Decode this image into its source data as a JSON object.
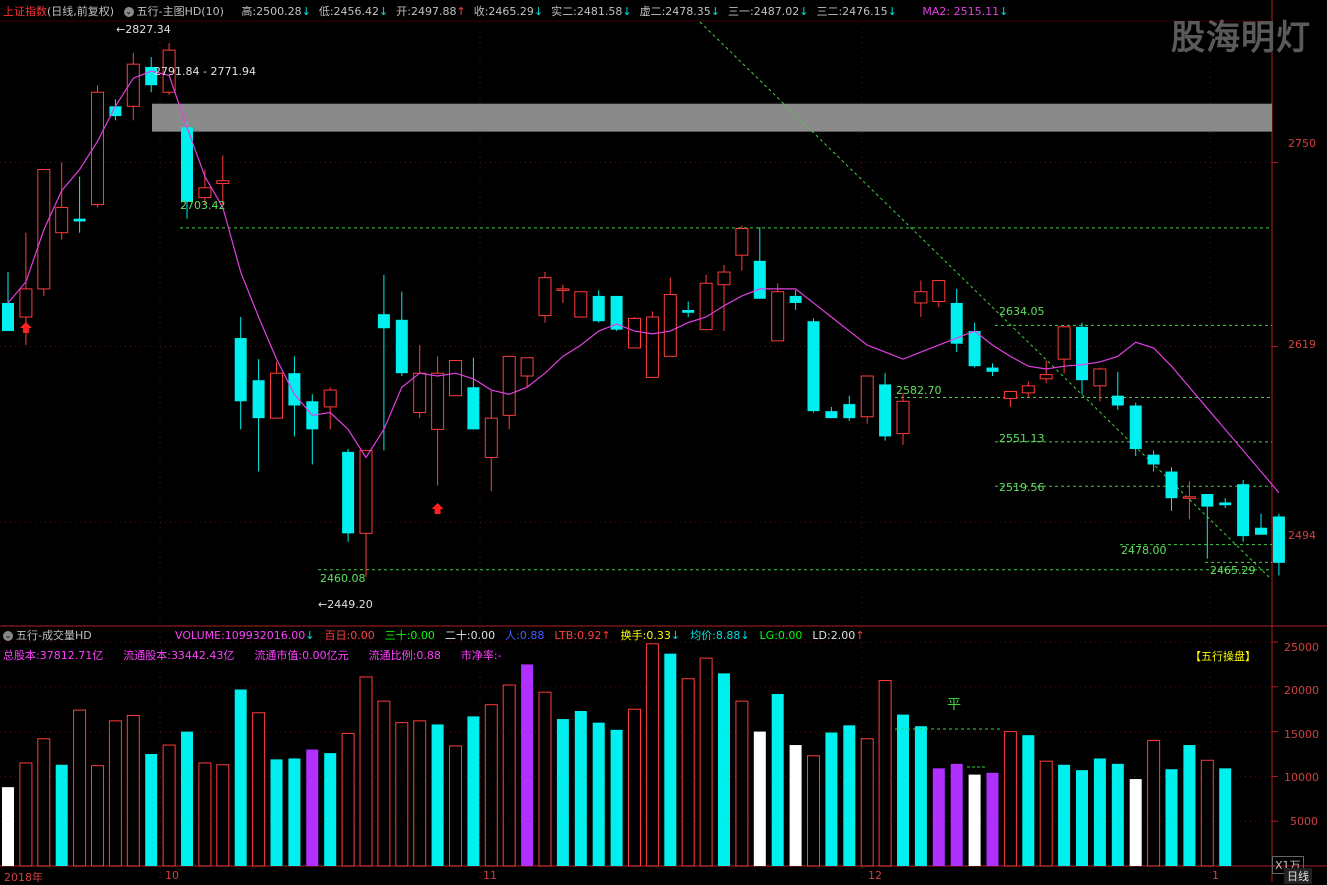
{
  "header": {
    "index_name": "上证指数",
    "period": "(日线,前复权)",
    "indicator_menu": "五行-主图HD(10)",
    "fields": [
      {
        "label": "高:",
        "value": "2500.28",
        "arrow": "↓",
        "color": "#00e0e0"
      },
      {
        "label": "低:",
        "value": "2456.42",
        "arrow": "↓",
        "color": "#00e0e0"
      },
      {
        "label": "开:",
        "value": "2497.88",
        "arrow": "↑",
        "color": "#ff4040"
      },
      {
        "label": "收:",
        "value": "2465.29",
        "arrow": "↓",
        "color": "#00e0e0"
      },
      {
        "label": "实二:",
        "value": "2481.58",
        "arrow": "↓",
        "color": "#00e0e0"
      },
      {
        "label": "虚二:",
        "value": "2478.35",
        "arrow": "↓",
        "color": "#00e0e0"
      },
      {
        "label": "三一:",
        "value": "2487.02",
        "arrow": "↓",
        "color": "#00e0e0"
      },
      {
        "label": "三二:",
        "value": "2476.15",
        "arrow": "↓",
        "color": "#00e0e0"
      }
    ],
    "ma2_label": "MA2: 2515.11",
    "ma2_arrow": "↓"
  },
  "watermark": "股海明灯",
  "price_axis": [
    "2750",
    "2619",
    "2494"
  ],
  "annotations": {
    "high_point": "2827.34",
    "band_range": "2791.84 - 2771.94",
    "level_2703": "2703.42",
    "level_2634": "2634.05",
    "level_2582": "2582.70",
    "level_2551": "2551.13",
    "level_2519": "2519.56",
    "level_2478": "2478.00",
    "level_2465": "2465.29",
    "level_2460": "2460.08",
    "low_point": "2449.20"
  },
  "volume_panel": {
    "title": "五行-成交量HD",
    "fields": [
      {
        "label": "VOLUME:",
        "value": "109932016.00",
        "arrow": "↓",
        "color": "#ff40ff"
      },
      {
        "label": "百日:",
        "value": "0.00",
        "arrow": "",
        "color": "#ff4040"
      },
      {
        "label": "三十:",
        "value": "0.00",
        "arrow": "",
        "color": "#00ff00"
      },
      {
        "label": "二十:",
        "value": "0.00",
        "arrow": "",
        "color": "#e0e0e0"
      },
      {
        "label": "人:",
        "value": "0.88",
        "arrow": "",
        "color": "#4060ff"
      },
      {
        "label": "LTB:",
        "value": "0.92",
        "arrow": "↑",
        "color": "#ff4040"
      },
      {
        "label": "换手:",
        "value": "0.33",
        "arrow": "↓",
        "color": "#ffff00"
      },
      {
        "label": "均价:",
        "value": "8.88",
        "arrow": "↓",
        "color": "#00e0e0"
      },
      {
        "label": "LG:",
        "value": "0.00",
        "arrow": "",
        "color": "#00ff00"
      },
      {
        "label": "LD:",
        "value": "2.00",
        "arrow": "↑",
        "color": "#e0e0e0"
      }
    ],
    "line2": [
      {
        "label": "总股本:",
        "value": "37812.71亿",
        "color": "#ff40ff"
      },
      {
        "label": "流通股本:",
        "value": "33442.43亿",
        "color": "#ff40ff"
      },
      {
        "label": "流通市值:",
        "value": "0.00亿元",
        "color": "#ff40ff"
      },
      {
        "label": "流通比例:",
        "value": "0.88",
        "color": "#ff40ff"
      },
      {
        "label": "市净率:",
        "value": "-",
        "color": "#ff40ff"
      }
    ],
    "operate_tag": "【五行操盘】",
    "flat_mark": "平",
    "axis": [
      "25000",
      "20000",
      "15000",
      "10000",
      "5000"
    ],
    "unit": "X1万"
  },
  "time_axis": [
    "2018年",
    "10",
    "11",
    "12",
    "1"
  ],
  "period_tab": "日线",
  "colors": {
    "up": "#ff3c3c",
    "down": "#00f0f0",
    "ma": "#e040e0",
    "level": "#40d040",
    "axis": "#b02020"
  },
  "chart_data": {
    "type": "candlestick",
    "ohlc": [
      [
        2650,
        2672,
        2632,
        2630
      ],
      [
        2640,
        2700,
        2620,
        2660
      ],
      [
        2660,
        2745,
        2655,
        2745
      ],
      [
        2700,
        2750,
        2695,
        2718
      ],
      [
        2710,
        2740,
        2700,
        2708
      ],
      [
        2720,
        2805,
        2718,
        2800
      ],
      [
        2790,
        2795,
        2780,
        2783
      ],
      [
        2790,
        2828,
        2780,
        2820
      ],
      [
        2818,
        2825,
        2800,
        2805
      ],
      [
        2800,
        2835,
        2798,
        2830
      ],
      [
        2775,
        2779,
        2710,
        2722
      ],
      [
        2725,
        2745,
        2720,
        2732
      ],
      [
        2735,
        2755,
        2720,
        2737
      ],
      [
        2625,
        2640,
        2560,
        2580
      ],
      [
        2595,
        2610,
        2530,
        2568
      ],
      [
        2568,
        2608,
        2568,
        2600
      ],
      [
        2600,
        2612,
        2555,
        2577
      ],
      [
        2580,
        2585,
        2535,
        2560
      ],
      [
        2576,
        2590,
        2560,
        2588
      ],
      [
        2544,
        2546,
        2480,
        2486
      ],
      [
        2486,
        2545,
        2455,
        2545
      ],
      [
        2642,
        2670,
        2545,
        2632
      ],
      [
        2638,
        2658,
        2598,
        2600
      ],
      [
        2572,
        2620,
        2568,
        2600
      ],
      [
        2560,
        2612,
        2520,
        2600
      ],
      [
        2584,
        2606,
        2592,
        2609
      ],
      [
        2590,
        2611,
        2560,
        2560
      ],
      [
        2540,
        2588,
        2516,
        2568
      ],
      [
        2570,
        2605,
        2560,
        2612
      ],
      [
        2598,
        2601,
        2590,
        2611
      ],
      [
        2641,
        2672,
        2636,
        2668
      ],
      [
        2660,
        2663,
        2650,
        2660
      ],
      [
        2640,
        2655,
        2640,
        2658
      ],
      [
        2655,
        2659,
        2636,
        2637
      ],
      [
        2655,
        2655,
        2630,
        2631
      ],
      [
        2618,
        2640,
        2618,
        2639
      ],
      [
        2597,
        2644,
        2605,
        2640
      ],
      [
        2612,
        2668,
        2615,
        2656
      ],
      [
        2645,
        2651,
        2640,
        2643
      ],
      [
        2631,
        2670,
        2632,
        2664
      ],
      [
        2663,
        2677,
        2630,
        2672
      ],
      [
        2684,
        2705,
        2673,
        2703
      ],
      [
        2680,
        2704,
        2653,
        2653
      ],
      [
        2623,
        2664,
        2628,
        2658
      ],
      [
        2655,
        2659,
        2645,
        2650
      ],
      [
        2637,
        2639,
        2572,
        2573
      ],
      [
        2573,
        2576,
        2569,
        2568
      ],
      [
        2578,
        2584,
        2566,
        2568
      ],
      [
        2569,
        2595,
        2564,
        2598
      ],
      [
        2592,
        2600,
        2552,
        2555
      ],
      [
        2557,
        2586,
        2549,
        2580
      ],
      [
        2650,
        2666,
        2640,
        2658
      ],
      [
        2651,
        2666,
        2647,
        2666
      ],
      [
        2650,
        2660,
        2615,
        2621
      ],
      [
        2630,
        2636,
        2604,
        2605
      ],
      [
        2604,
        2607,
        2598,
        2601
      ],
      [
        2582,
        2587,
        2576,
        2587
      ],
      [
        2586,
        2594,
        2583,
        2591
      ],
      [
        2596,
        2609,
        2593,
        2599
      ],
      [
        2610,
        2634,
        2600,
        2633
      ],
      [
        2633,
        2636,
        2585,
        2595
      ],
      [
        2591,
        2604,
        2580,
        2603
      ],
      [
        2584,
        2601,
        2574,
        2577
      ],
      [
        2577,
        2579,
        2541,
        2546
      ],
      [
        2542,
        2545,
        2530,
        2535
      ],
      [
        2530,
        2533,
        2502,
        2511
      ],
      [
        2512,
        2523,
        2496,
        2512
      ],
      [
        2514,
        2501,
        2468,
        2505
      ],
      [
        2508,
        2511,
        2504,
        2506
      ],
      [
        2521,
        2524,
        2480,
        2484
      ],
      [
        2490,
        2500,
        2485,
        2485
      ],
      [
        2498,
        2500,
        2456,
        2465
      ]
    ],
    "ma2": [
      2650,
      2665,
      2702,
      2730,
      2745,
      2765,
      2790,
      2810,
      2815,
      2812,
      2775,
      2740,
      2718,
      2672,
      2640,
      2610,
      2585,
      2570,
      2572,
      2560,
      2540,
      2560,
      2590,
      2600,
      2598,
      2600,
      2596,
      2588,
      2585,
      2590,
      2600,
      2612,
      2620,
      2630,
      2635,
      2630,
      2628,
      2630,
      2636,
      2640,
      2648,
      2655,
      2660,
      2660,
      2660,
      2650,
      2640,
      2630,
      2620,
      2615,
      2610,
      2615,
      2620,
      2625,
      2630,
      2620,
      2612,
      2605,
      2603,
      2605,
      2606,
      2608,
      2612,
      2622,
      2618,
      2605,
      2590,
      2575,
      2560,
      2545,
      2530,
      2515
    ],
    "volume": [
      8.8,
      11.5,
      14.2,
      11.3,
      17.4,
      11.2,
      16.2,
      16.8,
      12.5,
      13.5,
      15.0,
      11.5,
      11.3,
      19.7,
      17.1,
      11.9,
      12.0,
      13.0,
      12.6,
      14.8,
      21.1,
      18.4,
      16.0,
      16.2,
      15.8,
      13.4,
      16.7,
      18.0,
      20.2,
      22.5,
      19.4,
      16.4,
      17.3,
      16.0,
      15.2,
      17.5,
      24.8,
      23.7,
      20.9,
      23.2,
      21.5,
      18.4,
      15.0,
      19.2,
      13.5,
      12.3,
      14.9,
      15.7,
      14.2,
      20.7,
      16.9,
      15.6,
      10.9,
      11.4,
      10.2,
      10.4,
      15.0,
      14.6,
      11.7,
      11.3,
      10.7,
      12.0,
      11.4,
      9.7,
      14.0,
      10.8,
      13.5,
      11.8,
      10.9
    ],
    "volume_colors": [
      "w",
      "r",
      "r",
      "c",
      "r",
      "r",
      "r",
      "r",
      "c",
      "r",
      "c",
      "r",
      "r",
      "c",
      "r",
      "c",
      "c",
      "m",
      "c",
      "r",
      "r",
      "r",
      "r",
      "r",
      "c",
      "r",
      "c",
      "r",
      "r",
      "m",
      "r",
      "c",
      "c",
      "c",
      "c",
      "r",
      "r",
      "c",
      "r",
      "r",
      "c",
      "r",
      "w",
      "c",
      "w",
      "r",
      "c",
      "c",
      "r",
      "r",
      "c",
      "c",
      "m",
      "m",
      "w",
      "m",
      "r",
      "c",
      "r",
      "c",
      "c",
      "c",
      "c",
      "w",
      "r",
      "c",
      "c",
      "r",
      "c"
    ],
    "price_axis_range": [
      2430,
      2850
    ],
    "volume_axis_range": [
      0,
      25000
    ]
  }
}
